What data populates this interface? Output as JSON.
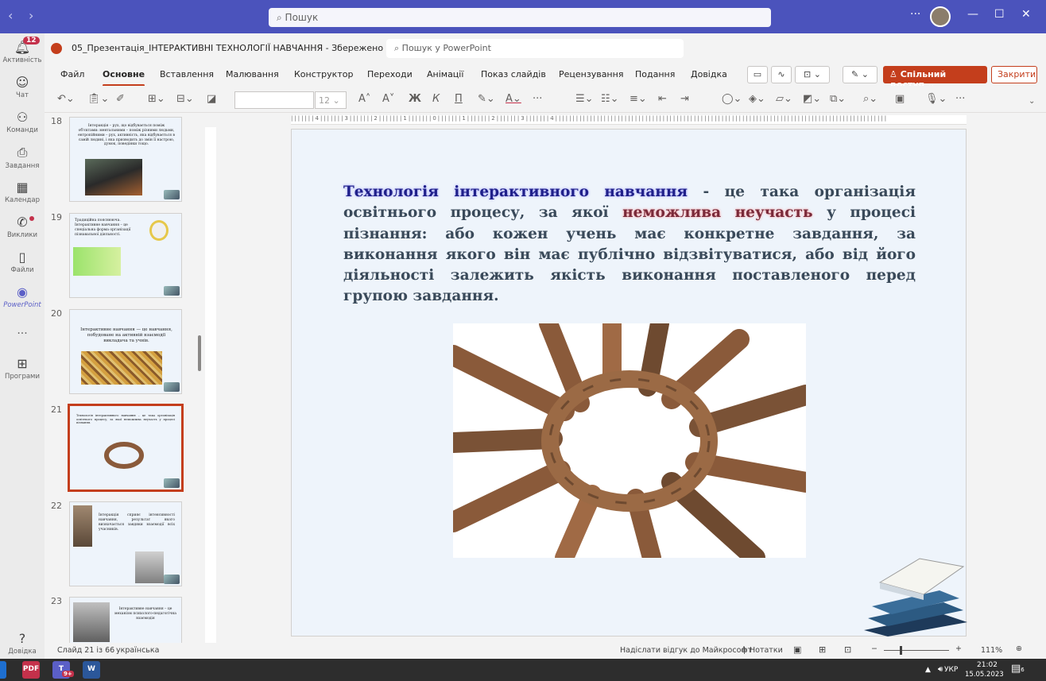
{
  "teams": {
    "search_placeholder": "Пошук",
    "more": "···",
    "minimize": "—",
    "maximize": "☐",
    "close": "✕",
    "back": "‹",
    "forward": "›"
  },
  "rail": {
    "items": [
      {
        "label": "Активність",
        "badge": "12"
      },
      {
        "label": "Чат"
      },
      {
        "label": "Команди"
      },
      {
        "label": "Завдання"
      },
      {
        "label": "Календар"
      },
      {
        "label": "Виклики"
      },
      {
        "label": "Файли"
      },
      {
        "label": "PowerPoint"
      },
      {
        "label": "···"
      },
      {
        "label": "Програми"
      },
      {
        "label": "Довідка"
      }
    ]
  },
  "doc": {
    "title": "05_Презентація_ІНТЕРАКТИВНІ ТЕХНОЛОГІЇ НАВЧАННЯ - Збережено",
    "search": "Пошук у PowerPoint"
  },
  "menu": {
    "items": [
      "Файл",
      "Основне",
      "Вставлення",
      "Малювання",
      "Конструктор",
      "Переходи",
      "Анімації",
      "Показ слайдів",
      "Рецензування",
      "Подання",
      "Довідка"
    ],
    "share": "Спільний доступ",
    "close": "Закрити"
  },
  "toolbar": {
    "font_size": "12"
  },
  "thumbs": [
    {
      "num": "18",
      "text": "Інтеракція – рух, що відбувається поміж об'єктами: ментальними – поміж різними людьми, ентропійними – рух, активність, яка відбувається в самій людині, і яка призводить до змін її настрою, думок, поведінки тощо."
    },
    {
      "num": "19",
      "text": "Традиційна пояснююча. Інтерактивне навчання – це спеціальна форма організації пізнавальної діяльності."
    },
    {
      "num": "20",
      "text": "Інтерактивне навчання — це навчання, побудоване на активній взаємодії викладача та учнів."
    },
    {
      "num": "21",
      "text": "Технологія інтерактивного навчання – це така організація освітнього процесу, за якої неможлива неучасть у процесі пізнання."
    },
    {
      "num": "22",
      "text": "Інтеракція сприяє інтенсивності навчання, результат якого визначається завдяки взаємодії всіх учасників."
    },
    {
      "num": "23",
      "text": "Інтерактивне навчання – це механізм психолого-педагогічна взаємодія"
    }
  ],
  "slide": {
    "term": "Технологія інтерактивного навчання",
    "part1": " - це така організація освітнього процесу, за якої ",
    "emph": "неможлива неучасть",
    "part2": " у процесі пізнання: або кожен учень має конкретне завдання, за виконання якого він має публічно відзвітуватися, або від його діяльності залежить якість виконання поставленого перед групою завдання."
  },
  "status": {
    "slide": "Слайд 21 із 66",
    "lang": "українська",
    "feedback": "Надіслати відгук до Майкрософт",
    "notes": "Нотатки",
    "zoom": "111%"
  },
  "taskbar": {
    "lang": "УКР",
    "time": "21:02",
    "date": "15.05.2023",
    "teams_badge": "9+",
    "notif": "6"
  }
}
